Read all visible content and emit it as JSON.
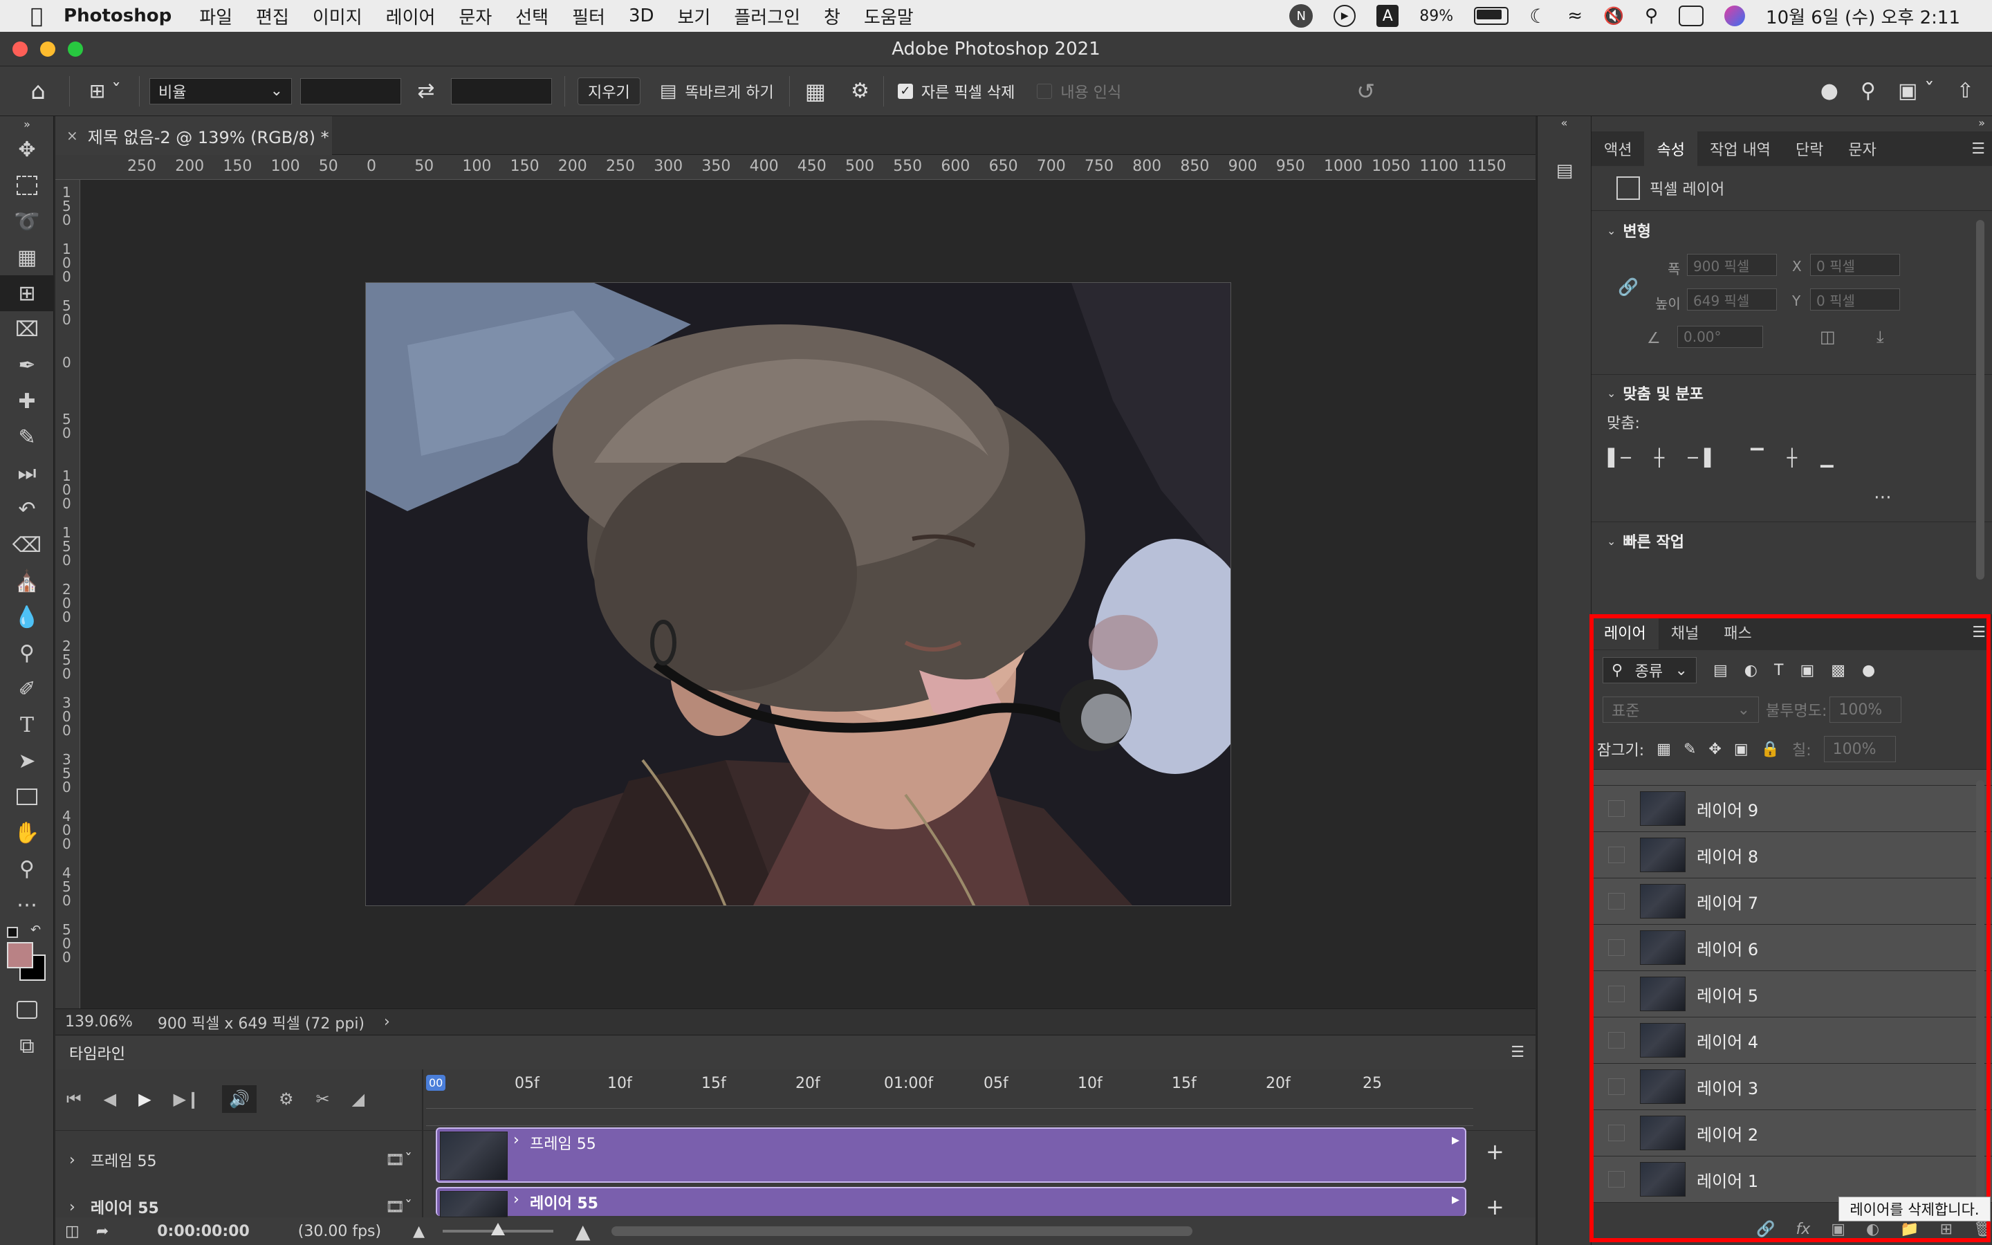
{
  "menubar": {
    "app": "Photoshop",
    "items": [
      "파일",
      "편집",
      "이미지",
      "레이어",
      "문자",
      "선택",
      "필터",
      "3D",
      "보기",
      "플러그인",
      "창",
      "도움말"
    ],
    "battery": "89%",
    "datetime": "10월 6일 (수) 오후 2:11"
  },
  "window": {
    "title": "Adobe Photoshop 2021"
  },
  "options": {
    "ratio": "비율",
    "clear": "지우기",
    "straighten": "똑바르게 하기",
    "delete_cropped": "자른 픽셀 삭제",
    "content_aware": "내용 인식"
  },
  "document": {
    "tab": "제목 없음-2 @ 139% (RGB/8) *",
    "zoom": "139.06%",
    "info": "900 픽셀 x 649 픽셀 (72 ppi)"
  },
  "ruler_top": [
    "250",
    "200",
    "150",
    "100",
    "50",
    "0",
    "50",
    "100",
    "150",
    "200",
    "250",
    "300",
    "350",
    "400",
    "450",
    "500",
    "550",
    "600",
    "650",
    "700",
    "750",
    "800",
    "850",
    "900",
    "950",
    "1000",
    "1050",
    "1100",
    "1150"
  ],
  "ruler_left": [
    "1\n5\n0",
    "1\n0\n0",
    "5\n0",
    "0",
    "5\n0",
    "1\n0\n0",
    "1\n5\n0",
    "2\n0\n0",
    "2\n5\n0",
    "3\n0\n0",
    "3\n5\n0",
    "4\n0\n0",
    "4\n5\n0",
    "5\n0\n0"
  ],
  "timeline": {
    "title": "타임라인",
    "marks": [
      "05f",
      "10f",
      "15f",
      "20f",
      "01:00f",
      "05f",
      "10f",
      "15f",
      "20f",
      "25"
    ],
    "playhead": "00",
    "tracks": [
      {
        "label": "프레임 55",
        "clip": "프레임 55"
      },
      {
        "label": "레이어 55",
        "clip": "레이어 55"
      }
    ],
    "timecode": "0:00:00:00",
    "fps": "(30.00 fps)"
  },
  "props_panel": {
    "tabs": [
      "액션",
      "속성",
      "작업 내역",
      "단락",
      "문자"
    ],
    "active_tab": "속성",
    "kind": "픽셀 레이어",
    "transform_title": "변형",
    "w_label": "폭",
    "w": "900 픽셀",
    "h_label": "높이",
    "h": "649 픽셀",
    "x_label": "X",
    "x": "0 픽셀",
    "y_label": "Y",
    "y": "0 픽셀",
    "angle": "0.00°",
    "align_title": "맞춤 및 분포",
    "align_label": "맞춤:",
    "quick_title": "빠른 작업"
  },
  "layers_panel": {
    "tabs": [
      "레이어",
      "채널",
      "패스"
    ],
    "active_tab": "레이어",
    "filter": "종류",
    "blend": "표준",
    "opacity_label": "불투명도:",
    "opacity": "100%",
    "lock_label": "잠그기:",
    "fill_label": "칠:",
    "fill": "100%",
    "layers": [
      "레이어 9",
      "레이어 8",
      "레이어 7",
      "레이어 6",
      "레이어 5",
      "레이어 4",
      "레이어 3",
      "레이어 2",
      "레이어 1"
    ],
    "tooltip": "레이어를 삭제합니다."
  }
}
